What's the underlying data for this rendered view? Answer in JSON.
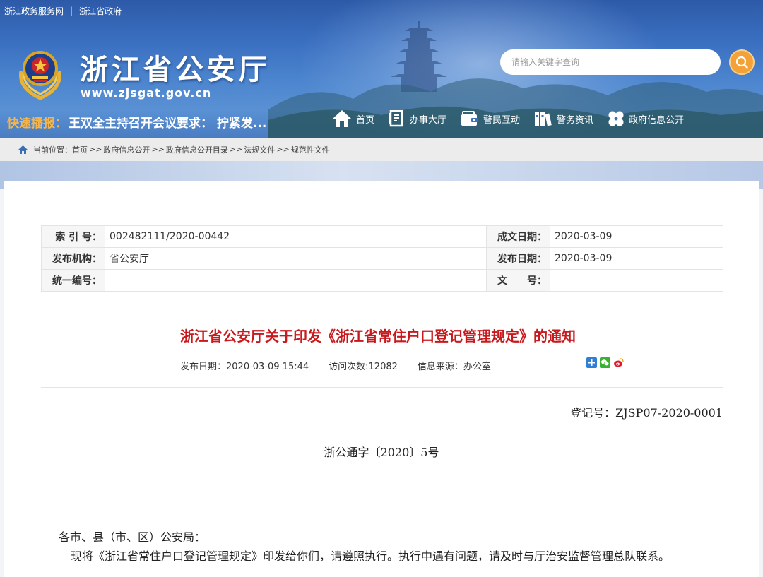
{
  "topbar": {
    "link1": "浙江政务服务网",
    "separator": "|",
    "link2": "浙江省政府"
  },
  "site": {
    "title": "浙江省公安厅",
    "url": "www.zjsgat.gov.cn"
  },
  "search": {
    "placeholder": "请输入关键字查询"
  },
  "quick_news": {
    "label": "快速播报：",
    "headline": "王双全主持召开会议要求： 拧紧发..."
  },
  "nav": [
    {
      "label": "首页",
      "icon": "home-icon"
    },
    {
      "label": "办事大厅",
      "icon": "document-icon"
    },
    {
      "label": "警民互动",
      "icon": "wallet-icon"
    },
    {
      "label": "警务资讯",
      "icon": "books-icon"
    },
    {
      "label": "政府信息公开",
      "icon": "clover-icon"
    }
  ],
  "breadcrumb": {
    "prefix": "当前位置：",
    "items": [
      "首页",
      "政府信息公开",
      "政府信息公开目录",
      "法规文件",
      "规范性文件"
    ],
    "separator": ">>"
  },
  "meta": {
    "index_label": "索 引 号：",
    "index_value": "002482111/2020-00442",
    "created_label": "成文日期：",
    "created_value": "2020-03-09",
    "org_label": "发布机构：",
    "org_value": "省公安厅",
    "pub_label": "发布日期：",
    "pub_value": "2020-03-09",
    "code_label": "统一编号：",
    "code_value": "",
    "docno_label": "文　　号：",
    "docno_value": ""
  },
  "document": {
    "title": "浙江省公安厅关于印发《浙江省常住户口登记管理规定》的通知",
    "publish_time": "发布日期：2020-03-09 15:44",
    "visits": "访问次数:12082",
    "source": "信息来源：办公室",
    "registration_no": "登记号：ZJSP07-2020-0001",
    "doc_number": "浙公通字〔2020〕5号",
    "salutation": "各市、县（市、区）公安局：",
    "paragraph": "现将《浙江省常住户口登记管理规定》印发给你们，请遵照执行。执行中遇有问题，请及时与厅治安监督管理总队联系。"
  },
  "colors": {
    "title_red": "#c8191c",
    "search_orange": "#f4a238",
    "quick_label": "#f5b54b"
  }
}
